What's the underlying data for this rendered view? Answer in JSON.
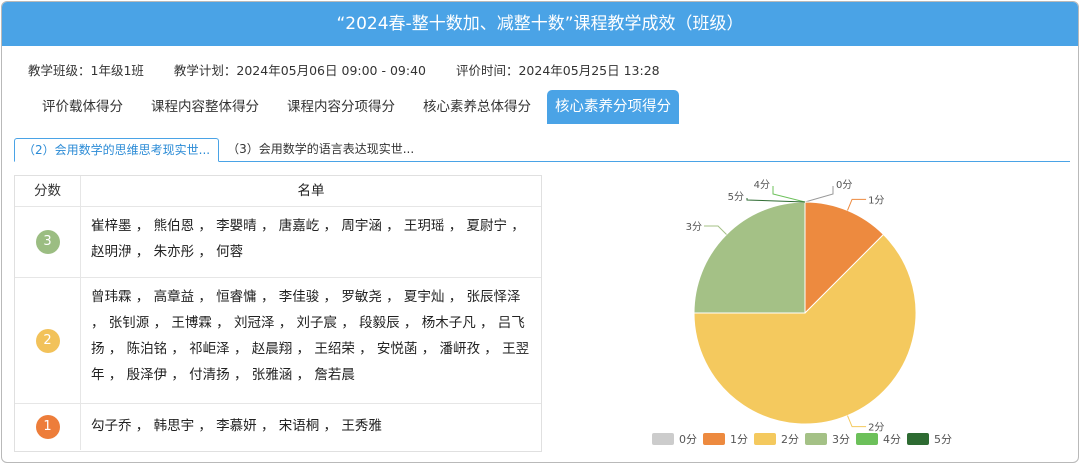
{
  "header": {
    "title": "“2024春-整十数加、减整十数”课程教学成效（班级）"
  },
  "meta": {
    "class_label": "教学班级：1年级1班",
    "plan_label": "教学计划：2024年05月06日 09:00 - 09:40",
    "eval_label": "评价时间：2024年05月25日 13:28"
  },
  "tabs": [
    {
      "label": "评价载体得分"
    },
    {
      "label": "课程内容整体得分"
    },
    {
      "label": "课程内容分项得分"
    },
    {
      "label": "核心素养总体得分"
    },
    {
      "label": "核心素养分项得分"
    }
  ],
  "subtabs": [
    {
      "label": "（2）会用数学的思维思考现实世..."
    },
    {
      "label": "（3）会用数学的语言表达现实世..."
    }
  ],
  "table": {
    "headers": {
      "score": "分数",
      "names": "名单"
    },
    "rows": [
      {
        "score": "3",
        "color": "#9bbd82",
        "names": "崔梓墨 ， 熊伯恩 ， 李嬰晴 ， 唐嘉屹 ， 周宇涵 ， 王玥瑶 ， 夏尉宁 ， 赵明洢 ， 朱亦彤 ， 何蓉"
      },
      {
        "score": "2",
        "color": "#f2c25a",
        "names": "曾玮霖 ， 高章益 ， 恒睿慵 ， 李佳骏 ， 罗敏尧 ， 夏宇灿 ， 张辰怿泽 ， 张钊源 ， 王博霖 ， 刘冠泽 ， 刘子宸 ， 段毅辰 ， 杨木子凡 ， 吕飞扬 ， 陈泊铭 ， 祁岠泽 ， 赵晨翔 ， 王绍荣 ， 安悦菡 ， 潘岍孜 ， 王翌年 ， 殷泽伊 ， 付清扬 ， 张雅涵 ， 詹若晨"
      },
      {
        "score": "1",
        "color": "#ed7d3a",
        "names": "勾子乔 ， 韩思宇 ， 李慕妍 ， 宋语桐 ， 王秀雅"
      }
    ]
  },
  "chart_data": {
    "type": "pie",
    "series": [
      {
        "name": "0分",
        "label": "0分",
        "value": 0,
        "color": "#cccccc"
      },
      {
        "name": "1分",
        "label": "1分",
        "value": 5,
        "color": "#ed8a3f"
      },
      {
        "name": "2分",
        "label": "2分",
        "value": 25,
        "color": "#f4c95e"
      },
      {
        "name": "3分",
        "label": "3分",
        "value": 10,
        "color": "#a4c186"
      },
      {
        "name": "4分",
        "label": "4分",
        "value": 0,
        "color": "#6cc05a"
      },
      {
        "name": "5分",
        "label": "5分",
        "value": 0,
        "color": "#2e6b32"
      }
    ],
    "legend": "bottom"
  }
}
